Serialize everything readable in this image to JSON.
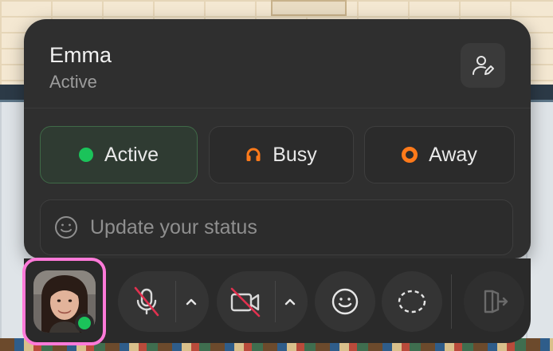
{
  "user": {
    "name": "Emma",
    "status": "Active"
  },
  "status_options": [
    {
      "label": "Active",
      "indicator": "green-dot-icon",
      "color": "#1bc35a",
      "selected": true
    },
    {
      "label": "Busy",
      "indicator": "headphones-icon",
      "color": "#ff7a1a",
      "selected": false
    },
    {
      "label": "Away",
      "indicator": "orange-ring-icon",
      "color": "#ff7a1a",
      "selected": false
    }
  ],
  "status_input": {
    "placeholder": "Update your status",
    "icon": "smiley-icon"
  },
  "toolbar": {
    "microphone": {
      "icon": "microphone-off-icon",
      "state": "muted"
    },
    "camera": {
      "icon": "camera-off-icon",
      "state": "off"
    },
    "emoji": {
      "icon": "smiley-icon"
    },
    "screen_share": {
      "icon": "dashed-circle-icon"
    },
    "leave": {
      "icon": "exit-door-icon"
    },
    "avatar_status_color": "#1bc35a"
  },
  "colors": {
    "panel": "#2f2f2f",
    "active_green": "#1bc35a",
    "busy_orange": "#ff7a1a",
    "avatar_highlight": "#ff7ad9",
    "muted_red": "#e0314f"
  }
}
